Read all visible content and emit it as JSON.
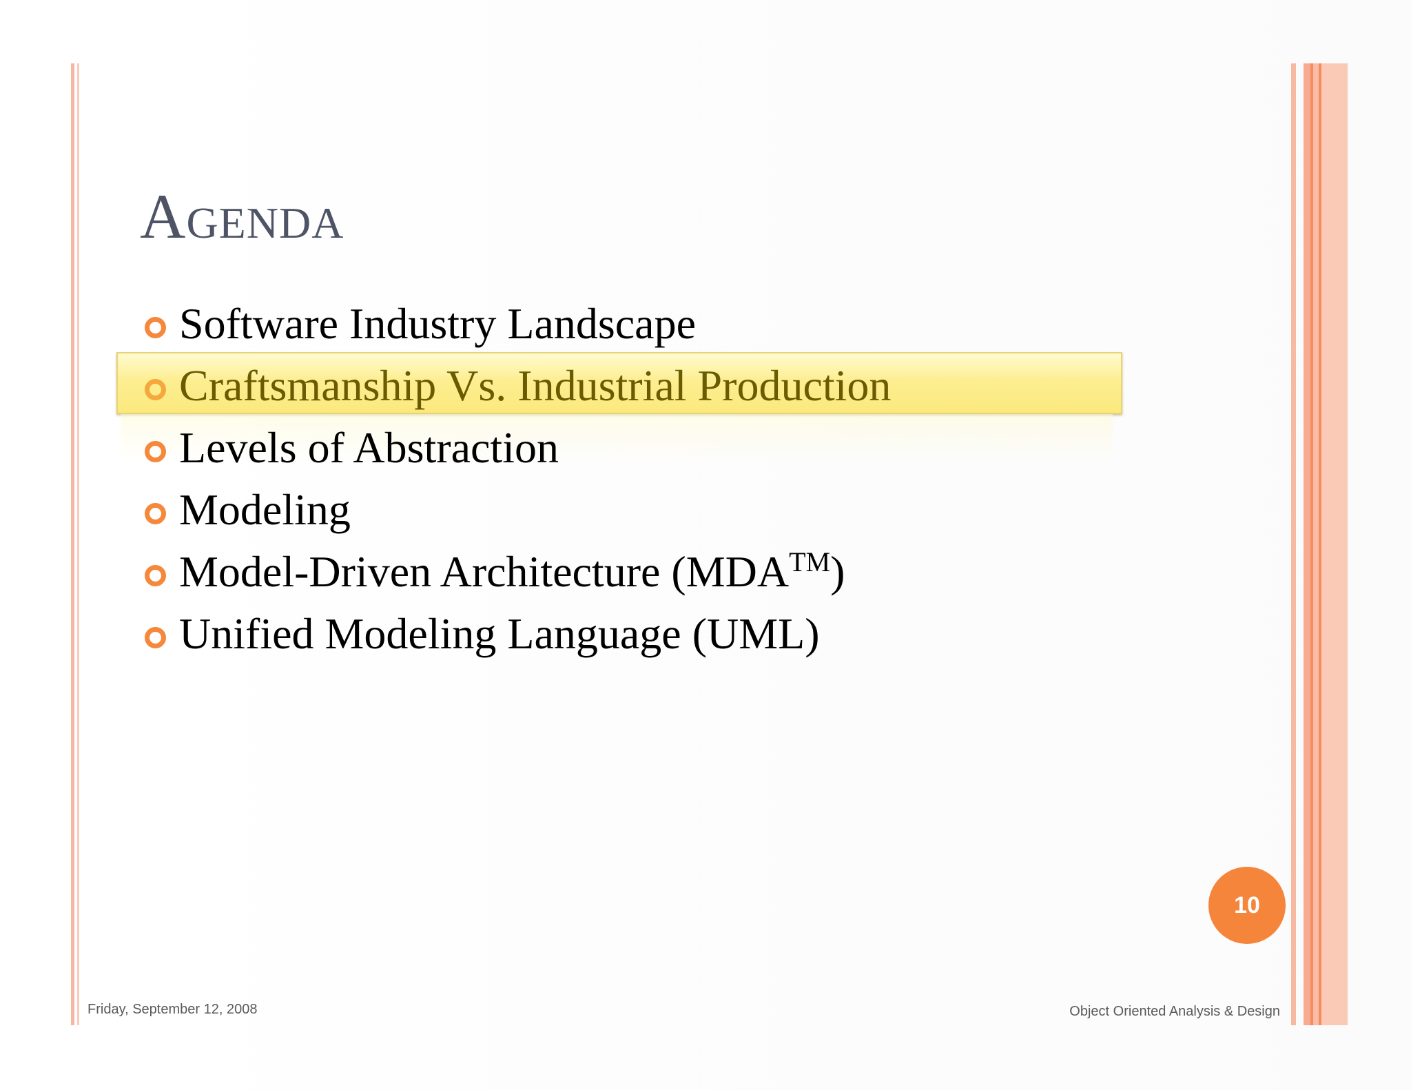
{
  "slide": {
    "title": "Agenda",
    "items": [
      {
        "text": "Software Industry Landscape",
        "highlighted": false
      },
      {
        "text": "Craftsmanship Vs. Industrial Production",
        "highlighted": true
      },
      {
        "text": "Levels of Abstraction",
        "highlighted": false
      },
      {
        "text": "Modeling",
        "highlighted": false
      },
      {
        "text": "Model-Driven Architecture (MDA",
        "suffix_sup": "TM",
        "suffix_after": ")",
        "highlighted": false
      },
      {
        "text": "Unified Modeling Language (UML)",
        "highlighted": false
      }
    ],
    "page_number": "10",
    "footer_date": "Friday, September 12, 2008",
    "footer_course": "Object Oriented Analysis & Design"
  },
  "colors": {
    "title": "#4e5465",
    "bullet": "#f5883b",
    "highlight": "#fbe97d",
    "highlight_text": "#6b5b00",
    "page_badge": "#f5853a",
    "border_stripe": "#f8b9a3"
  },
  "icons": {
    "bullet": "ring-bullet-icon"
  }
}
